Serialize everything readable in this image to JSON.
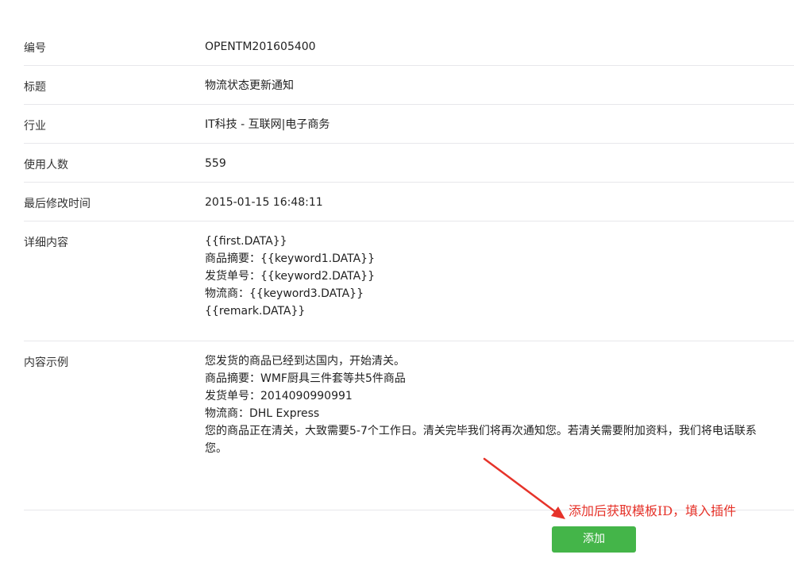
{
  "template": {
    "rows": [
      {
        "label": "编号",
        "value": "OPENTM201605400"
      },
      {
        "label": "标题",
        "value": "物流状态更新通知"
      },
      {
        "label": "行业",
        "value": "IT科技 - 互联网|电子商务"
      },
      {
        "label": "使用人数",
        "value": "559"
      },
      {
        "label": "最后修改时间",
        "value": "2015-01-15 16:48:11"
      }
    ],
    "detail": {
      "label": "详细内容",
      "lines": [
        "{{first.DATA}}",
        "商品摘要：{{keyword1.DATA}}",
        "发货单号：{{keyword2.DATA}}",
        "物流商：{{keyword3.DATA}}",
        "{{remark.DATA}}"
      ]
    },
    "example": {
      "label": "内容示例",
      "lines": [
        "您发货的商品已经到达国内，开始清关。",
        "商品摘要：WMF厨具三件套等共5件商品",
        "发货单号：2014090990991",
        "物流商：DHL Express",
        "您的商品正在清关，大致需要5-7个工作日。清关完毕我们将再次通知您。若清关需要附加资料，我们将电话联系您。"
      ]
    }
  },
  "annotation": {
    "text": "添加后获取模板ID，填入插件",
    "color": "#e6332a"
  },
  "actions": {
    "add_label": "添加",
    "add_color": "#44b549"
  }
}
